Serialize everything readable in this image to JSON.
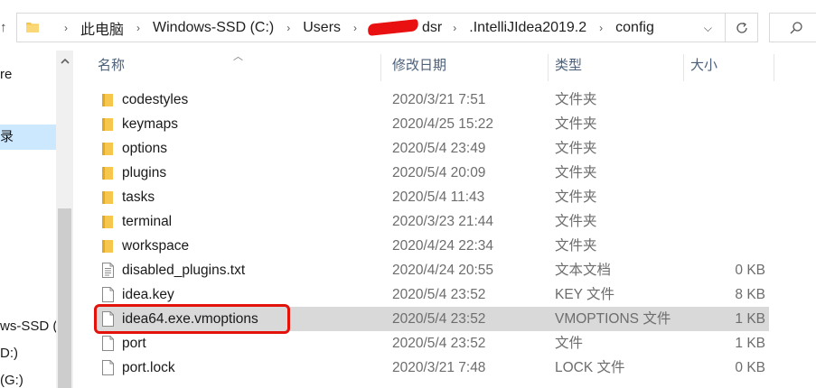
{
  "address_bar": {
    "crumbs": [
      "此电脑",
      "Windows-SSD (C:)",
      "Users",
      ".IntelliJIdea2019.2",
      "config"
    ],
    "redacted_tail": "dsr"
  },
  "nav": {
    "items": [
      {
        "label": "re",
        "selected": false
      },
      {
        "label": "录",
        "selected": true
      },
      {
        "label": "ws-SSD (",
        "selected": false
      },
      {
        "label": "D:)",
        "selected": false
      },
      {
        "label": "(G:)",
        "selected": false
      }
    ]
  },
  "columns": {
    "name": "名称",
    "date": "修改日期",
    "type": "类型",
    "size": "大小"
  },
  "files": [
    {
      "name": "codestyles",
      "date": "2020/3/21 7:51",
      "type": "文件夹",
      "size": "",
      "kind": "folder"
    },
    {
      "name": "keymaps",
      "date": "2020/4/25 15:22",
      "type": "文件夹",
      "size": "",
      "kind": "folder"
    },
    {
      "name": "options",
      "date": "2020/5/4 23:49",
      "type": "文件夹",
      "size": "",
      "kind": "folder"
    },
    {
      "name": "plugins",
      "date": "2020/5/4 20:09",
      "type": "文件夹",
      "size": "",
      "kind": "folder"
    },
    {
      "name": "tasks",
      "date": "2020/5/4 11:43",
      "type": "文件夹",
      "size": "",
      "kind": "folder"
    },
    {
      "name": "terminal",
      "date": "2020/3/23 21:44",
      "type": "文件夹",
      "size": "",
      "kind": "folder"
    },
    {
      "name": "workspace",
      "date": "2020/4/24 22:34",
      "type": "文件夹",
      "size": "",
      "kind": "folder"
    },
    {
      "name": "disabled_plugins.txt",
      "date": "2020/4/24 20:55",
      "type": "文本文档",
      "size": "0 KB",
      "kind": "text"
    },
    {
      "name": "idea.key",
      "date": "2020/5/4 23:52",
      "type": "KEY 文件",
      "size": "8 KB",
      "kind": "file"
    },
    {
      "name": "idea64.exe.vmoptions",
      "date": "2020/5/4 23:52",
      "type": "VMOPTIONS 文件",
      "size": "1 KB",
      "kind": "file",
      "highlighted": true
    },
    {
      "name": "port",
      "date": "2020/5/4 23:52",
      "type": "文件",
      "size": "1 KB",
      "kind": "file"
    },
    {
      "name": "port.lock",
      "date": "2020/3/21 7:48",
      "type": "LOCK 文件",
      "size": "0 KB",
      "kind": "file"
    }
  ],
  "colors": {
    "folder": "#f7c64c",
    "selection": "#cce8ff",
    "highlight_row": "#d9d9d9",
    "annotation": "#e3120b",
    "header_text": "#4c607a"
  }
}
